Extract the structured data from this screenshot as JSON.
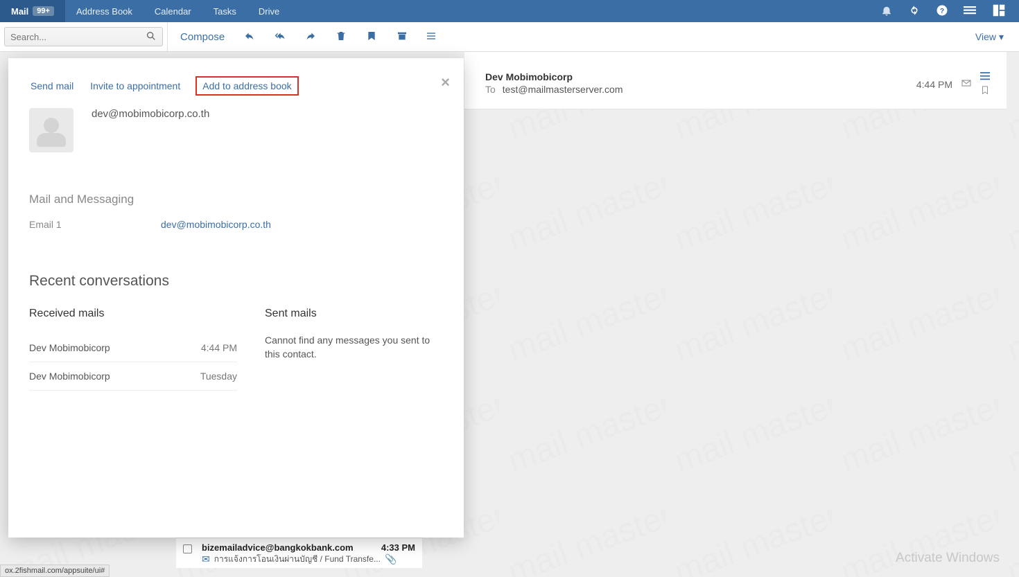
{
  "topnav": {
    "items": [
      {
        "label": "Mail",
        "badge": "99+"
      },
      {
        "label": "Address Book"
      },
      {
        "label": "Calendar"
      },
      {
        "label": "Tasks"
      },
      {
        "label": "Drive"
      }
    ]
  },
  "search": {
    "placeholder": "Search..."
  },
  "toolbar": {
    "compose": "Compose",
    "view": "View"
  },
  "mail": {
    "from_name": "Dev Mobimobicorp",
    "to_label": "To",
    "to_address": "test@mailmasterserver.com",
    "time": "4:44 PM"
  },
  "list_peek": {
    "from": "bizemailadvice@bangkokbank.com",
    "time": "4:33 PM",
    "subject": "การแจ้งการโอนเงินผ่านบัญชี / Fund Transfe..."
  },
  "statusbar": {
    "url": "ox.2fishmail.com/appsuite/ui#"
  },
  "activate": "Activate Windows",
  "popup": {
    "tabs": {
      "send_mail": "Send mail",
      "invite": "Invite to appointment",
      "add": "Add to address book"
    },
    "contact_email": "dev@mobimobicorp.co.th",
    "section_mail": "Mail and Messaging",
    "field_email1_label": "Email 1",
    "field_email1_value": "dev@mobimobicorp.co.th",
    "section_recent": "Recent conversations",
    "received_h": "Received mails",
    "sent_h": "Sent mails",
    "received": [
      {
        "name": "Dev Mobimobicorp",
        "time": "4:44 PM"
      },
      {
        "name": "Dev Mobimobicorp",
        "time": "Tuesday"
      }
    ],
    "sent_empty": "Cannot find any messages you sent to this contact."
  }
}
